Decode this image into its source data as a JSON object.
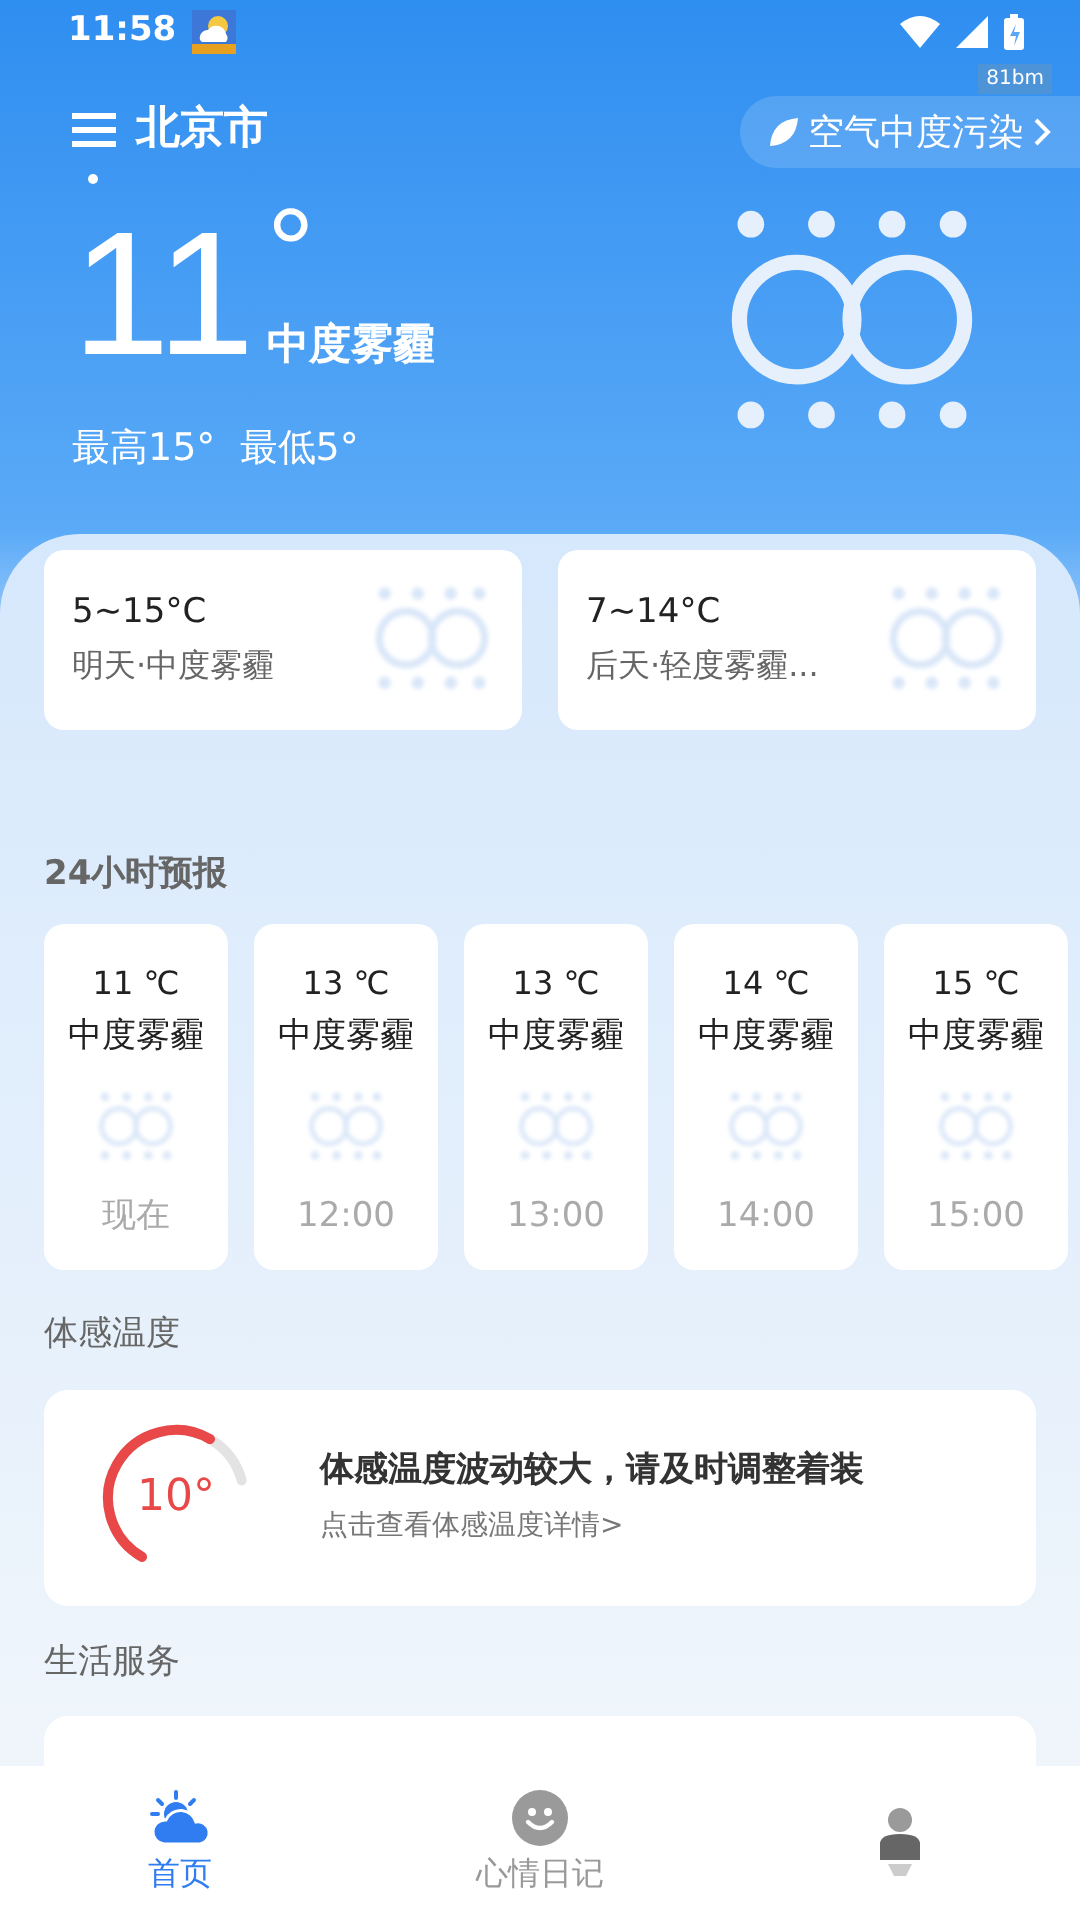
{
  "status_bar": {
    "time": "11:58",
    "badge": "81bm"
  },
  "header": {
    "city": "北京市",
    "air_quality": "空气中度污染",
    "temperature": "11",
    "degree": "°",
    "condition": "中度雾霾",
    "high_low": "最高15°  最低5°"
  },
  "daily": [
    {
      "range": "5~15°C",
      "desc": "明天·中度雾霾"
    },
    {
      "range": "7~14°C",
      "desc": "后天·轻度雾霾..."
    }
  ],
  "hourly": {
    "title": "24小时预报",
    "items": [
      {
        "temp": "11 ℃",
        "condition": "中度雾霾",
        "time": "现在"
      },
      {
        "temp": "13 ℃",
        "condition": "中度雾霾",
        "time": "12:00"
      },
      {
        "temp": "13 ℃",
        "condition": "中度雾霾",
        "time": "13:00"
      },
      {
        "temp": "14 ℃",
        "condition": "中度雾霾",
        "time": "14:00"
      },
      {
        "temp": "15 ℃",
        "condition": "中度雾霾",
        "time": "15:00"
      }
    ]
  },
  "feels_like": {
    "title": "体感温度",
    "value": "10°",
    "level": 0.8,
    "message": "体感温度波动较大，请及时调整着装",
    "link": "点击查看体感温度详情>"
  },
  "life_services": {
    "title": "生活服务"
  },
  "nav": [
    {
      "kind": "home",
      "label": "首页",
      "selected": true
    },
    {
      "kind": "mood",
      "label": "心情日记",
      "selected": false
    },
    {
      "kind": "profile",
      "selected": false
    }
  ]
}
